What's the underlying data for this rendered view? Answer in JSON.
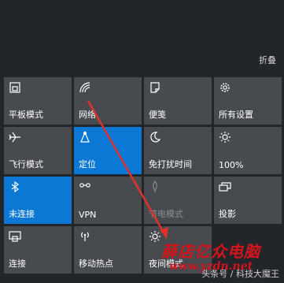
{
  "action_center": {
    "collapse_label": "折叠",
    "tiles": [
      {
        "label": "平板模式",
        "icon": "tablet-mode-icon",
        "state": "off"
      },
      {
        "label": "网络",
        "icon": "network-icon",
        "state": "off"
      },
      {
        "label": "便笺",
        "icon": "note-icon",
        "state": "off"
      },
      {
        "label": "所有设置",
        "icon": "gear-icon",
        "state": "off"
      },
      {
        "label": "飞行模式",
        "icon": "airplane-icon",
        "state": "off"
      },
      {
        "label": "定位",
        "icon": "location-icon",
        "state": "on"
      },
      {
        "label": "免打扰时间",
        "icon": "moon-icon",
        "state": "off"
      },
      {
        "label": "100%",
        "icon": "brightness-icon",
        "state": "off"
      },
      {
        "label": "未连接",
        "icon": "bluetooth-icon",
        "state": "on"
      },
      {
        "label": "VPN",
        "icon": "vpn-icon",
        "state": "off"
      },
      {
        "label": "节电模式",
        "icon": "battery-saver-icon",
        "state": "disabled"
      },
      {
        "label": "投影",
        "icon": "project-icon",
        "state": "off"
      },
      {
        "label": "连接",
        "icon": "connect-icon",
        "state": "off"
      },
      {
        "label": "移动热点",
        "icon": "hotspot-icon",
        "state": "off"
      },
      {
        "label": "夜间模式",
        "icon": "night-light-icon",
        "state": "off"
      }
    ]
  },
  "watermark": {
    "text": "薛店亿众电脑",
    "url": "www.yzdn.net",
    "source": "头条号 / 科技大魔王"
  },
  "colors": {
    "accent": "#0a78d4",
    "tile": "#474b50",
    "background": "#22262b",
    "arrow": "#e0322b"
  }
}
